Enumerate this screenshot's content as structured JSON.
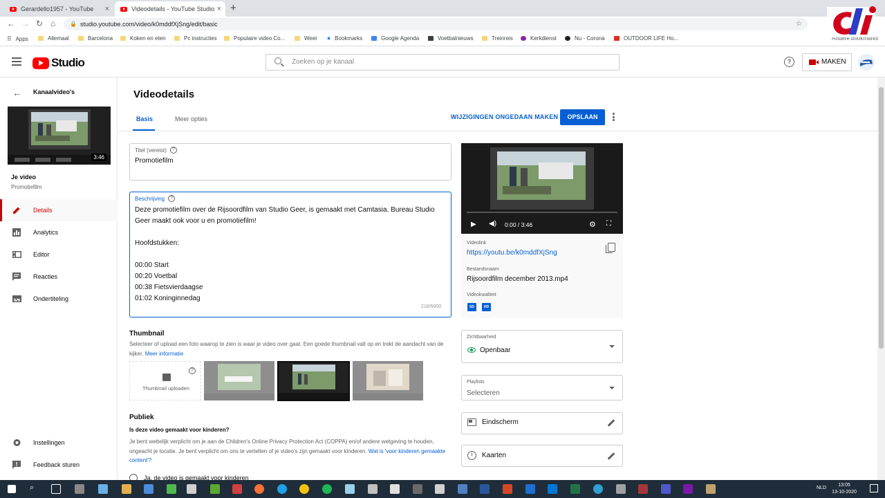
{
  "browser": {
    "tabs": [
      {
        "title": "Gerardello1957 - YouTube"
      },
      {
        "title": "Videodetails - YouTube Studio"
      }
    ],
    "url": "studio.youtube.com/video/k0mddfXjSng/edit/basic",
    "bookmarks": [
      "Apps",
      "Allemaal",
      "Barcelona",
      "Koken en eten",
      "Pc instructies",
      "Populaire video Co...",
      "Weer",
      "Bookmarks",
      "Google Agenda",
      "Voetbalnieuws",
      "Treinreis",
      "Kerkdienst",
      "Nu - Corona",
      "OUTDOOR LIFE Ho..."
    ],
    "other_bookmarks": "Andere bookmarks"
  },
  "header": {
    "logo_text": "Studio",
    "search_placeholder": "Zoeken op je kanaal",
    "create_label": "MAKEN"
  },
  "sidebar": {
    "back_label": "Kanaalvideo's",
    "thumb_duration": "3:46",
    "video_title": "Je video",
    "video_subtitle": "Promotiefilm",
    "items": [
      {
        "label": "Details",
        "icon": "pencil-icon"
      },
      {
        "label": "Analytics",
        "icon": "analytics-icon"
      },
      {
        "label": "Editor",
        "icon": "editor-icon"
      },
      {
        "label": "Reacties",
        "icon": "comments-icon"
      },
      {
        "label": "Ondertiteling",
        "icon": "subtitles-icon"
      }
    ],
    "active_item": "Details",
    "settings_label": "Instellingen",
    "feedback_label": "Feedback sturen"
  },
  "main": {
    "title": "Videodetails",
    "tabs": [
      {
        "label": "Basis"
      },
      {
        "label": "Meer opties"
      }
    ],
    "active_tab": "Basis",
    "undo_label": "WIJZIGINGEN ONGEDAAN MAKEN",
    "save_label": "OPSLAAN",
    "title_field": {
      "label": "Titel (vereist)",
      "value": "Promotiefilm"
    },
    "description_field": {
      "label": "Beschrijving",
      "value": "Deze promotiefilm over de Rijsoordfilm van Studio Geer, is gemaakt met Camtasia. Bureau Studio Geer maakt ook voor u en promotiefilm!\n\nHoofdstukken:\n\n00:00 Start\n00:20 Voetbal\n00:38 Fietsvierdaagse\n01:02 Koninginnedag",
      "counter": "218/5000"
    },
    "thumbnail": {
      "heading": "Thumbnail",
      "text": "Selecteer of upload een foto waarop te zien is waar je video over gaat. Een goede thumbnail valt op en trekt de aandacht van de kijker.",
      "link": "Meer informatie",
      "upload_label": "Thumbnail uploaden"
    },
    "audience": {
      "heading": "Publiek",
      "question": "Is deze video gemaakt voor kinderen?",
      "text": "Je bent wettelijk verplicht om je aan de Children's Online Privacy Protection Act (COPPA) en/of andere wetgeving te houden, ongeacht je locatie. Je bent verplicht om ons te vertellen of je video's zijn gemaakt voor kinderen.",
      "link": "Wat is 'voor kinderen gemaakte content'?",
      "option_yes": "Ja, de video is gemaakt voor kinderen"
    }
  },
  "right": {
    "player_time": "0:00 / 3:46",
    "video_link_label": "Videolink",
    "video_link": "https://youtu.be/k0mddfXjSng",
    "filename_label": "Bestandsnaam",
    "filename": "Rijsoordfilm december 2013.mp4",
    "quality_label": "Videokwaliteit",
    "quality_badges": [
      "SD",
      "HD"
    ],
    "visibility_label": "Zichtbaarheid",
    "visibility_value": "Openbaar",
    "playlists_label": "Playlists",
    "playlists_value": "Selecteren",
    "endscreen_label": "Eindscherm",
    "cards_label": "Kaarten"
  },
  "taskbar": {
    "language": "NLD",
    "time": "13:05",
    "date": "13-10-2020"
  },
  "colors": {
    "accent": "#065fd4",
    "brand_red": "#ff0000",
    "active_nav": "#cc0000",
    "visibility_green": "#0f9d58"
  }
}
